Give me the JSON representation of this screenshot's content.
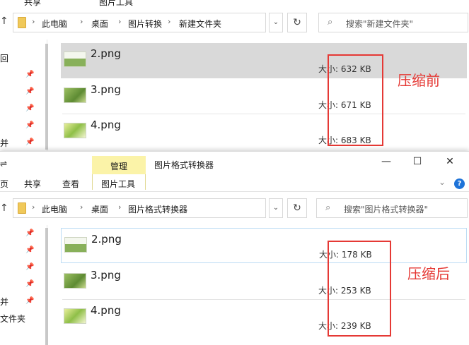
{
  "top_window": {
    "ribbon_partial": [
      "共享",
      "图片工具"
    ],
    "breadcrumb": [
      "此电脑",
      "桌面",
      "图片转换",
      "新建文件夹"
    ],
    "search_placeholder": "搜索\"新建文件夹\"",
    "nav_items": [
      "回",
      "并"
    ],
    "files": [
      {
        "name": "2.png",
        "size": "大小: 632 KB"
      },
      {
        "name": "3.png",
        "size": "大小: 671 KB"
      },
      {
        "name": "4.png",
        "size": "大小: 683 KB"
      }
    ],
    "annotation": "压缩前"
  },
  "bottom_window": {
    "title": "图片格式转换器",
    "context_tab_header": "管理",
    "ribbon_tabs": [
      "页",
      "共享",
      "查看",
      "图片工具"
    ],
    "window_controls": {
      "minimize": "—",
      "maximize": "☐",
      "close": "✕"
    },
    "breadcrumb": [
      "此电脑",
      "桌面",
      "图片格式转换器"
    ],
    "search_placeholder": "搜索\"图片格式转换器\"",
    "nav_items": [
      "并",
      "文件夹"
    ],
    "files": [
      {
        "name": "2.png",
        "size": "大小: 178 KB"
      },
      {
        "name": "3.png",
        "size": "大小: 253 KB"
      },
      {
        "name": "4.png",
        "size": "大小: 239 KB"
      }
    ],
    "annotation": "压缩后"
  },
  "colors": {
    "selection": "#d9d9d9",
    "annotation_red": "#e53935",
    "context_tab": "#fbf3a8",
    "help_blue": "#1e73d8"
  }
}
